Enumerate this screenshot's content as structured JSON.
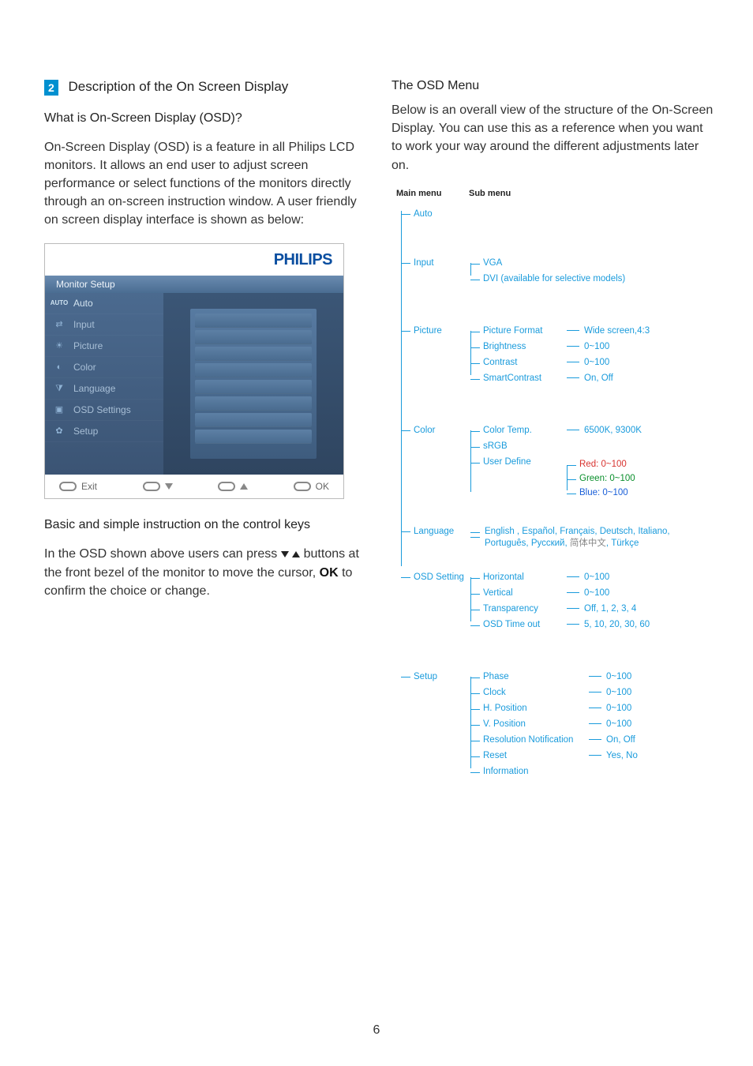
{
  "left": {
    "section_num": "2",
    "section_title": "Description of the On Screen Display",
    "q1": "What is On-Screen Display (OSD)?",
    "p1": "On-Screen Display (OSD) is a feature in all Philips LCD monitors. It allows an end user to adjust screen performance or select functions of the monitors directly through an on-screen instruction window. A user friendly on screen display interface is shown as below:",
    "osd": {
      "brand": "PHILIPS",
      "title": "Monitor Setup",
      "items": [
        {
          "icon": "AUTO",
          "label": "Auto",
          "selected": true
        },
        {
          "icon": "⇄",
          "label": "Input"
        },
        {
          "icon": "☀",
          "label": "Picture"
        },
        {
          "icon": "◐",
          "label": "Color"
        },
        {
          "icon": "⧩",
          "label": "Language"
        },
        {
          "icon": "▣",
          "label": "OSD Settings"
        },
        {
          "icon": "✿",
          "label": "Setup"
        }
      ],
      "footer": {
        "exit": "Exit",
        "ok": "OK"
      }
    },
    "h2": "Basic and simple instruction on the control keys",
    "p2a": "In the OSD shown above users can press ",
    "p2b": " buttons at the front bezel of the monitor to move the cursor, ",
    "p2c": "OK",
    "p2d": " to confirm the choice or change."
  },
  "right": {
    "h": "The OSD Menu",
    "p": "Below is an overall view of the structure of the On-Screen Display. You can use this as a reference when you want to work your way around the different adjustments later on.",
    "mm": "Main menu",
    "sm": "Sub menu",
    "tree": {
      "auto": "Auto",
      "input": {
        "lbl": "Input",
        "sub": [
          {
            "l": "VGA"
          },
          {
            "l": "DVI (available for selective models)"
          }
        ]
      },
      "picture": {
        "lbl": "Picture",
        "sub": [
          {
            "l": "Picture Format",
            "v": "Wide screen,4:3"
          },
          {
            "l": "Brightness",
            "v": "0~100"
          },
          {
            "l": "Contrast",
            "v": "0~100"
          },
          {
            "l": "SmartContrast",
            "v": "On, Off"
          }
        ]
      },
      "color": {
        "lbl": "Color",
        "sub": [
          {
            "l": "Color Temp.",
            "v": "6500K, 9300K"
          },
          {
            "l": "sRGB"
          },
          {
            "l": "User Define",
            "ud": [
              {
                "t": "Red: 0~100",
                "c": "red"
              },
              {
                "t": "Green: 0~100",
                "c": "green"
              },
              {
                "t": "Blue: 0~100",
                "c": "blue"
              }
            ]
          }
        ]
      },
      "language": {
        "lbl": "Language",
        "line1": "English , Español, Français, Deutsch, Italiano,",
        "line2a": "Português, Русский, ",
        "line2_cn": "简体中文",
        "line2b": ", Türkçe"
      },
      "osdsetting": {
        "lbl": "OSD Setting",
        "sub": [
          {
            "l": "Horizontal",
            "v": "0~100"
          },
          {
            "l": "Vertical",
            "v": "0~100"
          },
          {
            "l": "Transparency",
            "v": "Off, 1, 2, 3, 4"
          },
          {
            "l": "OSD Time out",
            "v": "5, 10, 20, 30, 60"
          }
        ]
      },
      "setup": {
        "lbl": "Setup",
        "sub": [
          {
            "l": "Phase",
            "v": "0~100"
          },
          {
            "l": "Clock",
            "v": "0~100"
          },
          {
            "l": "H. Position",
            "v": "0~100"
          },
          {
            "l": "V. Position",
            "v": "0~100"
          },
          {
            "l": "Resolution Notification",
            "v": "On, Off"
          },
          {
            "l": "Reset",
            "v": "Yes, No"
          },
          {
            "l": "Information"
          }
        ]
      }
    }
  },
  "page_num": "6"
}
